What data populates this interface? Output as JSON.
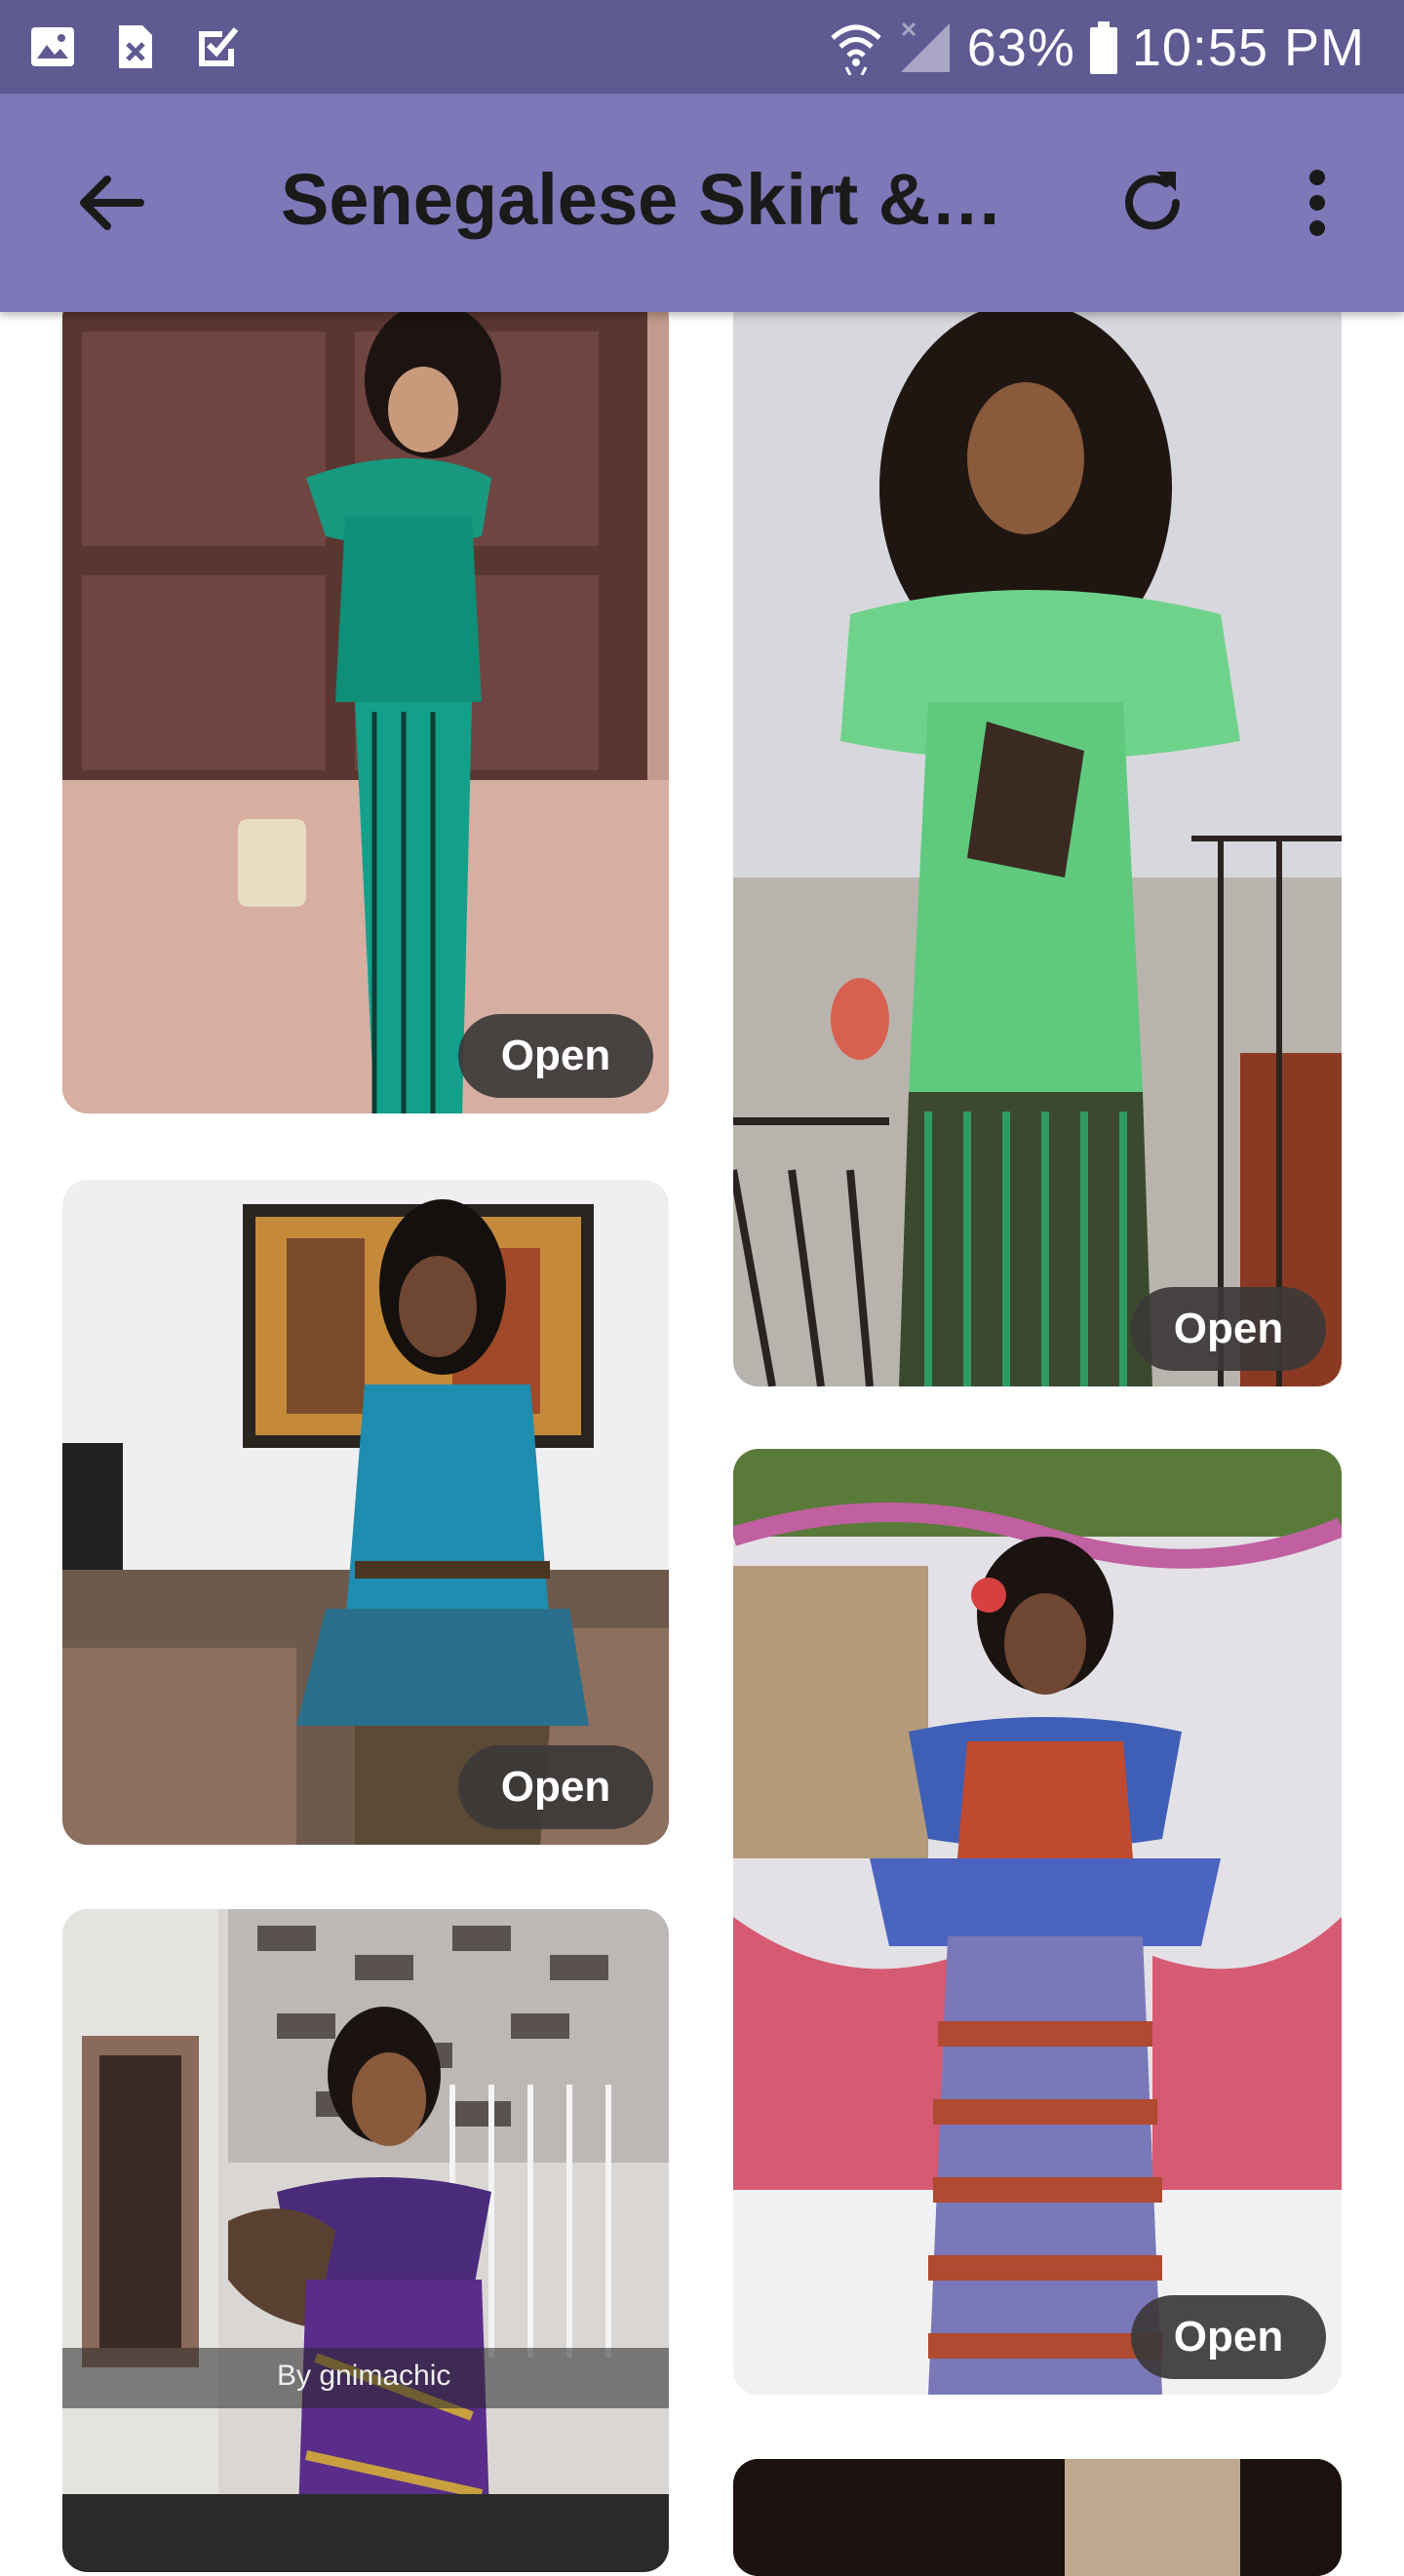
{
  "status_bar": {
    "battery": "63%",
    "time": "10:55 PM",
    "icons": [
      "gallery-icon",
      "close-file-icon",
      "checkbox-icon",
      "wifi-icon",
      "no-signal-icon",
      "battery-icon"
    ]
  },
  "app_bar": {
    "title": "Senegalese Skirt &…",
    "icons": [
      "back-arrow-icon",
      "refresh-icon",
      "more-vert-icon"
    ],
    "color": "#7e78b8"
  },
  "gallery": {
    "open_label": "Open",
    "cards": [
      {
        "name": "card-teal-silk-skirt",
        "accent": "#1aa58e"
      },
      {
        "name": "card-green-ruffle-dress",
        "accent": "#6fd28a"
      },
      {
        "name": "card-blue-peplum-dress",
        "accent": "#1f8db0"
      },
      {
        "name": "card-tie-dye-dress",
        "accent": "#3f5fb7"
      },
      {
        "name": "card-purple-ruffle-dress",
        "accent": "#5a2d8a",
        "credit": "By gnimachic"
      }
    ]
  }
}
